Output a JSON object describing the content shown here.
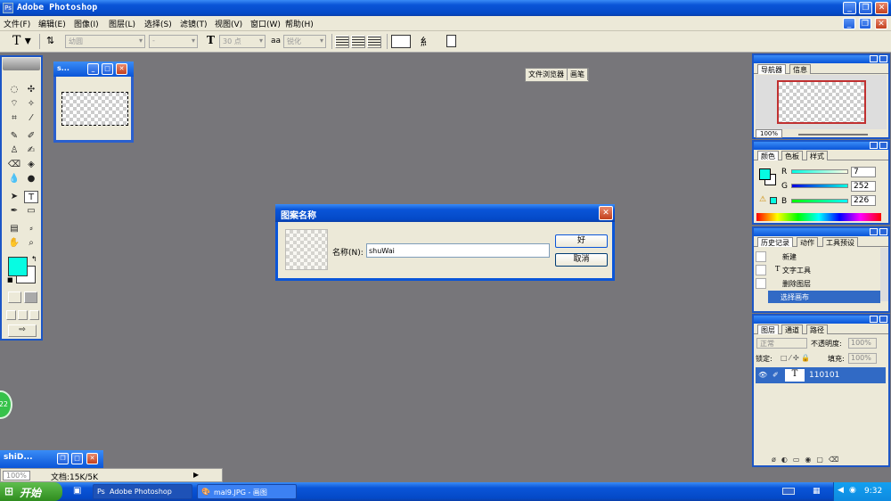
{
  "app": {
    "title": "Adobe Photoshop",
    "icon": "photoshop-app-icon"
  },
  "menu": [
    "文件(F)",
    "编辑(E)",
    "图像(I)",
    "图层(L)",
    "选择(S)",
    "滤镜(T)",
    "视图(V)",
    "窗口(W)",
    "帮助(H)"
  ],
  "options": {
    "font_family": "幼圆",
    "font_style": "-",
    "font_size": "30 点",
    "aa_label": "aa",
    "antialias": "锐化",
    "palette_tabs": [
      "文件浏览器",
      "画笔"
    ]
  },
  "doc_window": {
    "title": "s...",
    "zoom": "100%",
    "status": "文档:15K/5K",
    "min_title": "shiD..."
  },
  "dialog": {
    "title": "图案名称",
    "name_label": "名称(N):",
    "name_value": "shuWai",
    "ok": "好",
    "cancel": "取消"
  },
  "navigator": {
    "tabs": [
      "导航器",
      "信息"
    ],
    "zoom": "100%"
  },
  "color": {
    "tabs": [
      "颜色",
      "色板",
      "样式"
    ],
    "labels": [
      "R",
      "G",
      "B"
    ],
    "values": [
      "7",
      "252",
      "226"
    ],
    "fg": "#07fce2",
    "bg": "#ffffff"
  },
  "history": {
    "tabs": [
      "历史记录",
      "动作",
      "工具预设"
    ],
    "items": [
      "新建",
      "文字工具",
      "删除图层",
      "选择画布"
    ]
  },
  "layers": {
    "tabs": [
      "图层",
      "通道",
      "路径"
    ],
    "mode": "正常",
    "opacity_label": "不透明度:",
    "opacity": "100%",
    "lock_label": "锁定:",
    "fill_label": "填充:",
    "fill": "100%",
    "layer_name": "110101"
  },
  "taskbar": {
    "start": "开始",
    "items": [
      "Adobe Photoshop",
      "mal9.JPG - 画图"
    ],
    "clock": "9:32",
    "badge": "22"
  }
}
